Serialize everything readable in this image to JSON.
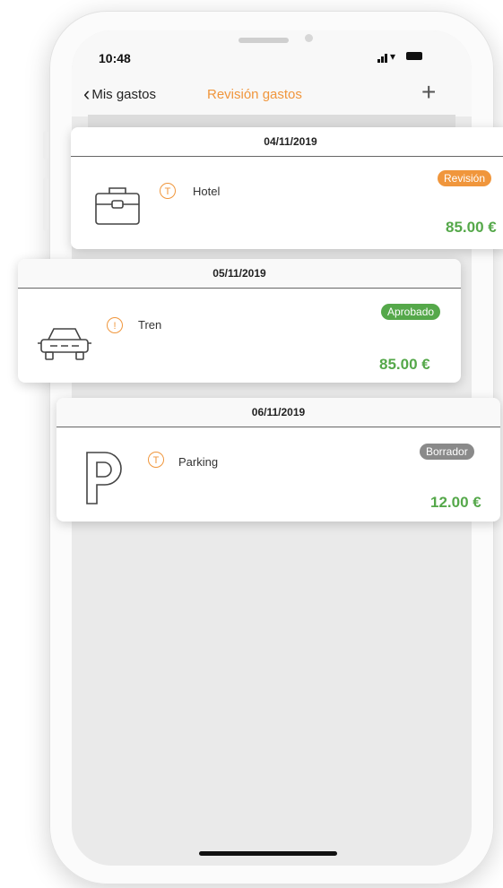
{
  "status_bar": {
    "time": "10:48"
  },
  "nav": {
    "back_label": "Mis gastos",
    "title": "Revisión gastos",
    "add_symbol": "+"
  },
  "colors": {
    "accent_orange": "#f0963c",
    "approved_green": "#55a84a",
    "draft_gray": "#8a8a8a",
    "amount_green": "#55a84a"
  },
  "expenses": [
    {
      "date": "04/11/2019",
      "type_icon": "briefcase-icon",
      "indicator": "T",
      "label": "Hotel",
      "status": "Revisión",
      "status_color": "#f0963c",
      "amount": "85.00 €"
    },
    {
      "date": "05/11/2019",
      "type_icon": "car-icon",
      "indicator": "!",
      "label": "Tren",
      "status": "Aprobado",
      "status_color": "#55a84a",
      "amount": "85.00 €"
    },
    {
      "date": "06/11/2019",
      "type_icon": "parking-icon",
      "indicator": "T",
      "label": "Parking",
      "status": "Borrador",
      "status_color": "#8a8a8a",
      "amount": "12.00 €"
    }
  ]
}
